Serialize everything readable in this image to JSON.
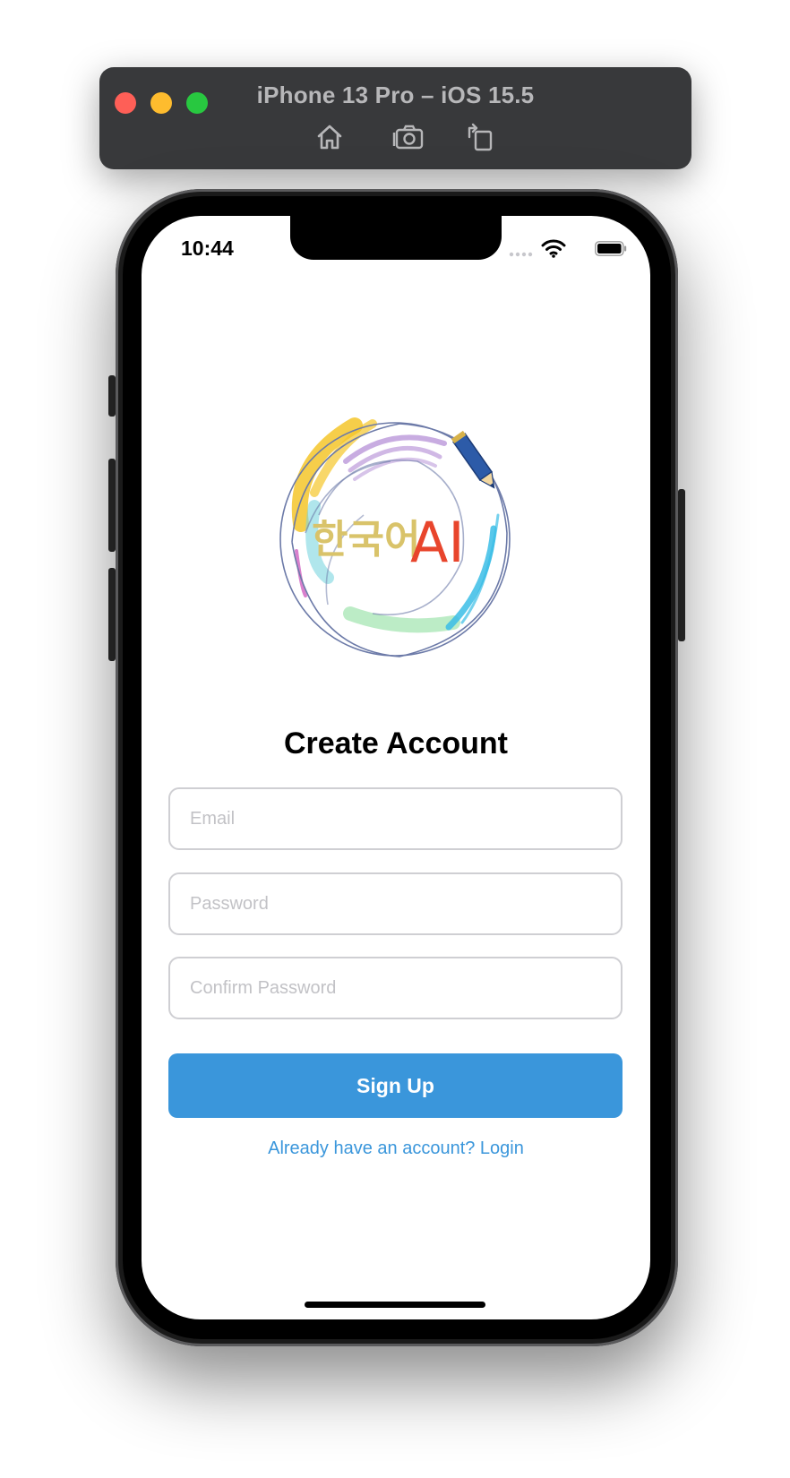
{
  "simulator": {
    "title": "iPhone 13 Pro – iOS 15.5",
    "toolbar": [
      "home-icon",
      "screenshot-icon",
      "rotate-icon"
    ]
  },
  "status_bar": {
    "time": "10:44"
  },
  "logo": {
    "korean_text": "한국어",
    "ai_text": "AI"
  },
  "form": {
    "title": "Create Account",
    "email_placeholder": "Email",
    "password_placeholder": "Password",
    "confirm_placeholder": "Confirm Password",
    "signup_label": "Sign Up",
    "login_link": "Already have an account? Login"
  },
  "colors": {
    "accent": "#3a96db",
    "logo_korean": "#d9c36a",
    "logo_ai": "#e8452c"
  }
}
